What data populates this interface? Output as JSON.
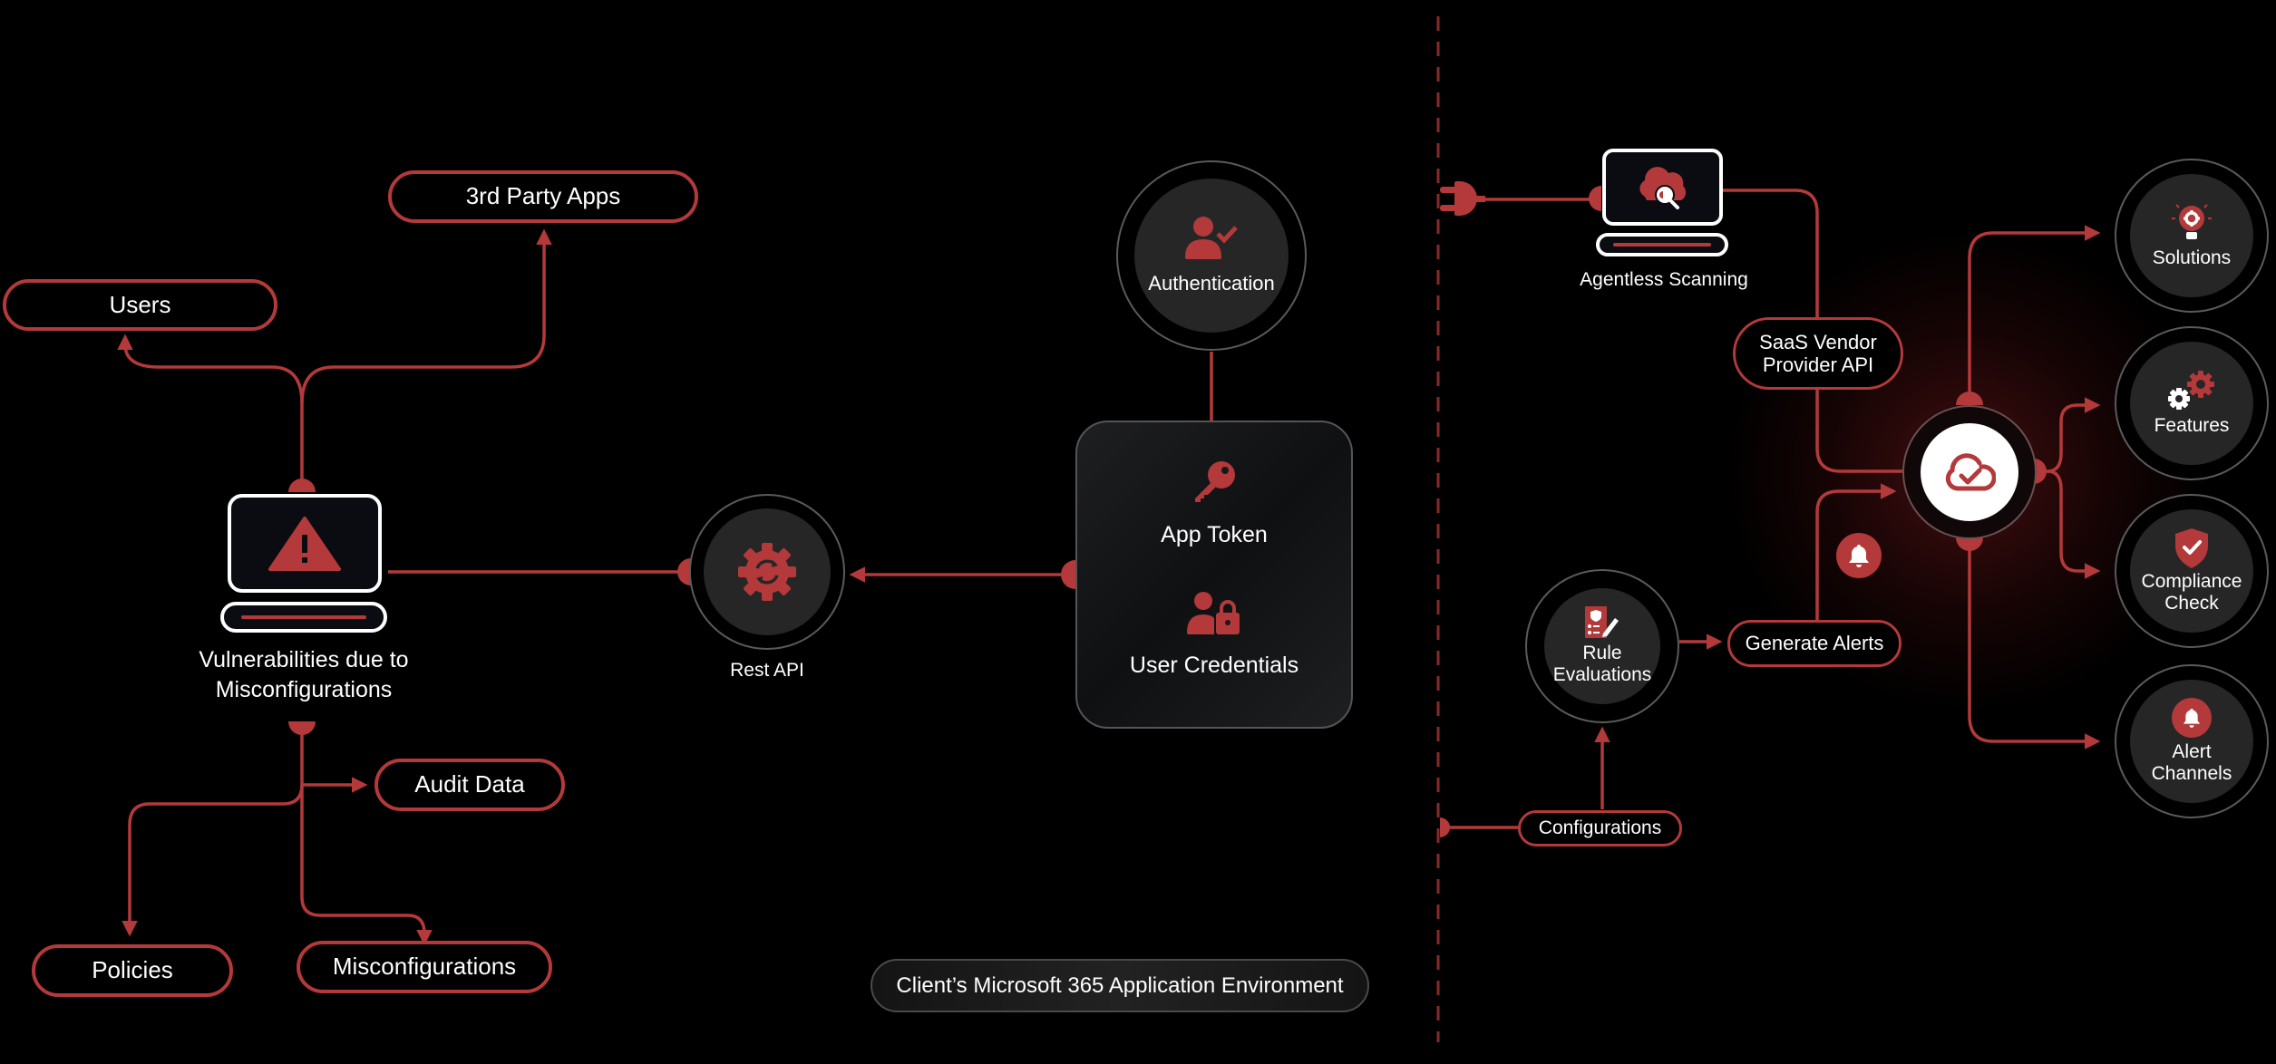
{
  "diagram": {
    "accent_color": "#b3393a",
    "background_color": "#000000",
    "left": {
      "source_node": {
        "label_line1": "Vulnerabilities due to",
        "label_line2": "Misconfigurations",
        "icon": "warning-triangle-icon"
      },
      "outputs_top": [
        {
          "label": "Users"
        },
        {
          "label": "3rd Party Apps"
        }
      ],
      "outputs_bottom": [
        {
          "label": "Audit Data"
        },
        {
          "label": "Policies"
        },
        {
          "label": "Misconfigurations"
        }
      ],
      "rest_api": {
        "label": "Rest API",
        "icon": "gear-sync-icon"
      },
      "authentication": {
        "label": "Authentication",
        "icon": "user-check-icon"
      },
      "credentials_box": {
        "items": [
          {
            "label": "App Token",
            "icon": "key-icon"
          },
          {
            "label": "User Credentials",
            "icon": "user-lock-icon"
          }
        ]
      },
      "environment_label": "Client’s Microsoft 365 Application Environment"
    },
    "right": {
      "agentless": {
        "label": "Agentless Scanning",
        "icon": "cloud-search-icon"
      },
      "saas_api": {
        "line1": "SaaS Vendor",
        "line2": "Provider API"
      },
      "hub": {
        "icon": "cloud-check-icon"
      },
      "alert_badge": {
        "icon": "bell-icon"
      },
      "rule_evaluations": {
        "line1": "Rule",
        "line2": "Evaluations",
        "icon": "checklist-shield-icon"
      },
      "generate_alerts": {
        "label": "Generate Alerts"
      },
      "configurations": {
        "label": "Configurations"
      },
      "outputs": [
        {
          "line1": "Solutions",
          "line2": "",
          "icon": "lightbulb-gear-icon"
        },
        {
          "line1": "Features",
          "line2": "",
          "icon": "gears-icon"
        },
        {
          "line1": "Compliance",
          "line2": "Check",
          "icon": "shield-check-icon"
        },
        {
          "line1": "Alert",
          "line2": "Channels",
          "icon": "bell-icon"
        }
      ]
    }
  }
}
